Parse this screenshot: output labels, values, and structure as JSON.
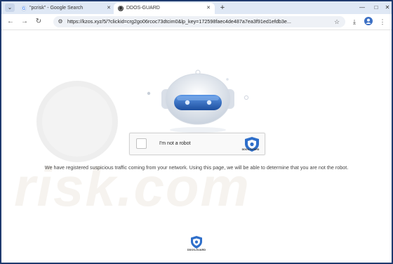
{
  "browser": {
    "tabs": [
      {
        "title": "\"pcrisk\" - Google Search",
        "favicon": "google-g",
        "active": false
      },
      {
        "title": "DDOS-GUARD",
        "favicon": "ddos-guard",
        "active": true
      }
    ],
    "new_tab_label": "+",
    "url": "https://kzos.xyz/5/?clickid=crg2go06rcoc73dtcim0&lp_key=172598faec4de487a7ea3f91ed1efdb3e..."
  },
  "captcha": {
    "checkbox_label": "I'm not a robot",
    "brand": "DDOS-GUARD",
    "checked": false
  },
  "notice": "We have registered suspicious traffic coming from your network. Using this page, we will be able to determine that you are not the robot.",
  "footer": {
    "brand": "DDOS-GUARD"
  },
  "colors": {
    "accent": "#3b7ad6",
    "shield": "#2f6fca",
    "frame": "#1f3a6e"
  }
}
